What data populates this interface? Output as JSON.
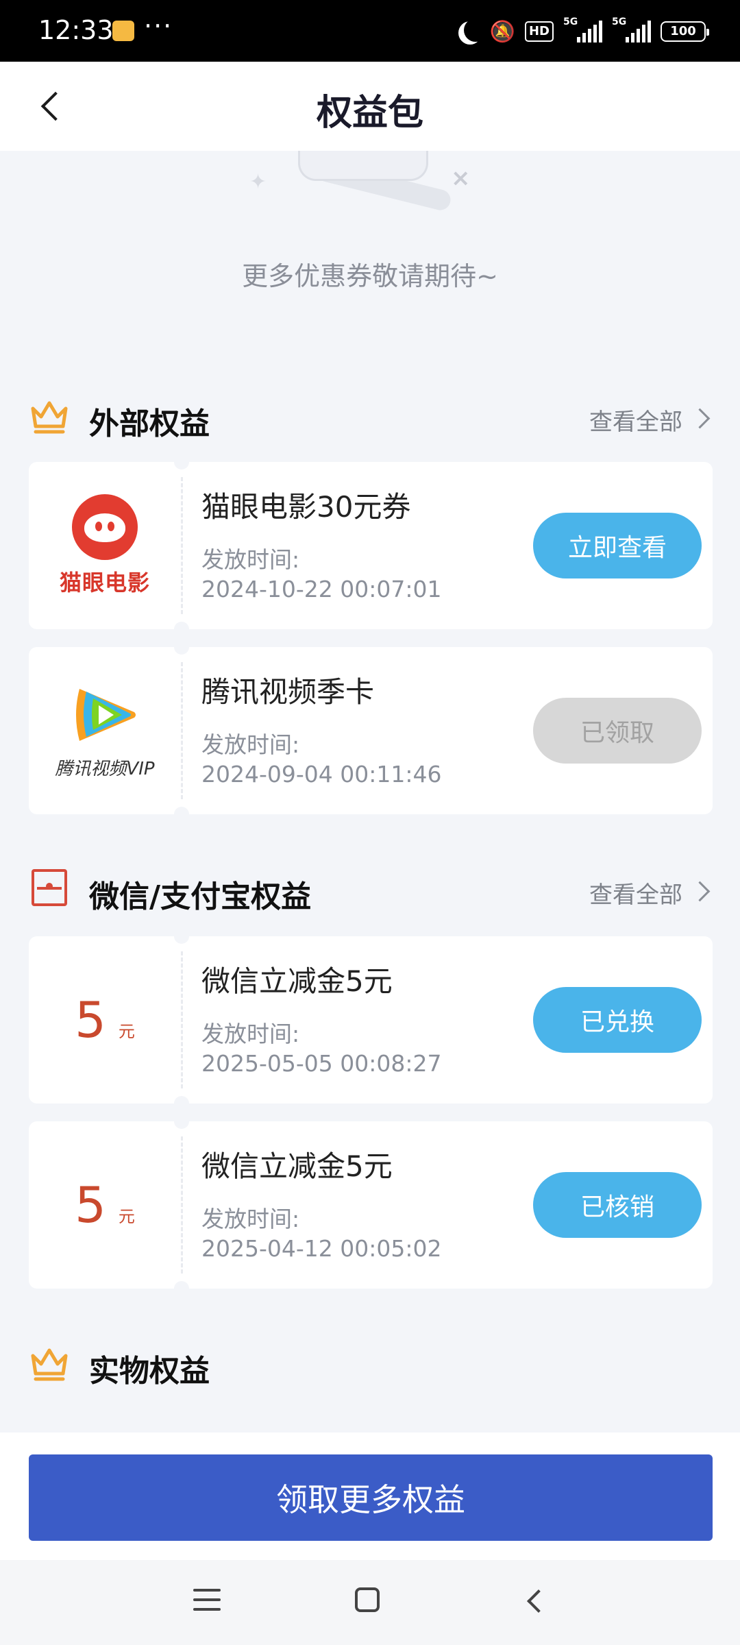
{
  "status_bar": {
    "time": "12:33",
    "dots": "···",
    "network_labels": [
      "5G",
      "5G"
    ],
    "hd_label": "HD",
    "battery": "100"
  },
  "header": {
    "title": "权益包"
  },
  "empty_state": {
    "text": "更多优惠券敬请期待~"
  },
  "sections": [
    {
      "title": "外部权益",
      "view_all": "查看全部",
      "icon": "crown-icon",
      "items": [
        {
          "logo": "maoyan-logo",
          "logo_text": "猫眼电影",
          "name": "猫眼电影30元券",
          "time_label": "发放时间:",
          "time": "2024-10-22 00:07:01",
          "button": "立即查看",
          "button_state": "active"
        },
        {
          "logo": "tencent-video-logo",
          "logo_text": "腾讯视频VIP",
          "name": "腾讯视频季卡",
          "time_label": "发放时间:",
          "time": "2024-09-04 00:11:46",
          "button": "已领取",
          "button_state": "disabled"
        }
      ]
    },
    {
      "title": "微信/支付宝权益",
      "view_all": "查看全部",
      "icon": "envelope-icon",
      "items": [
        {
          "amount": "5",
          "unit": "元",
          "name": "微信立减金5元",
          "time_label": "发放时间:",
          "time": "2025-05-05 00:08:27",
          "button": "已兑换",
          "button_state": "active"
        },
        {
          "amount": "5",
          "unit": "元",
          "name": "微信立减金5元",
          "time_label": "发放时间:",
          "time": "2025-04-12 00:05:02",
          "button": "已核销",
          "button_state": "active"
        }
      ]
    },
    {
      "title": "实物权益",
      "icon": "crown-icon"
    }
  ],
  "cta": {
    "label": "领取更多权益"
  },
  "colors": {
    "accent_blue": "#4ab4ea",
    "cta_blue": "#3b5cc7",
    "amount_red": "#c9492d",
    "crown_gold": "#f0a535"
  }
}
